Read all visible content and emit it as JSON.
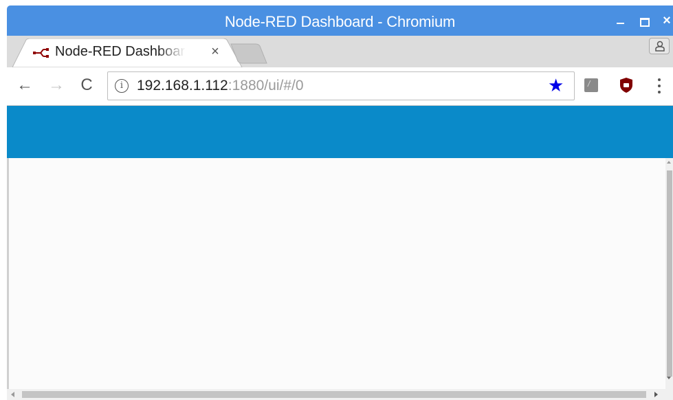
{
  "window": {
    "title": "Node-RED Dashboard - Chromium",
    "controls": {
      "minimize": "_",
      "maximize": "□",
      "close": "×"
    },
    "titlebar_color": "#4a90e2"
  },
  "tabs": [
    {
      "label": "Node-RED Dashboard",
      "favicon": "node-red-icon",
      "close": "×",
      "active": true
    }
  ],
  "toolbar": {
    "back": "←",
    "forward": "→",
    "reload": "C",
    "info_icon": "i",
    "url_host": "192.168.1.112",
    "url_path": ":1880/ui/#/0",
    "bookmark_star": "★",
    "star_color": "#0000e8",
    "extensions": [
      "ext-1-icon",
      "ublock-origin-icon"
    ],
    "menu_icon": "more-vert-icon"
  },
  "page": {
    "header_color": "#0a8ac9"
  }
}
